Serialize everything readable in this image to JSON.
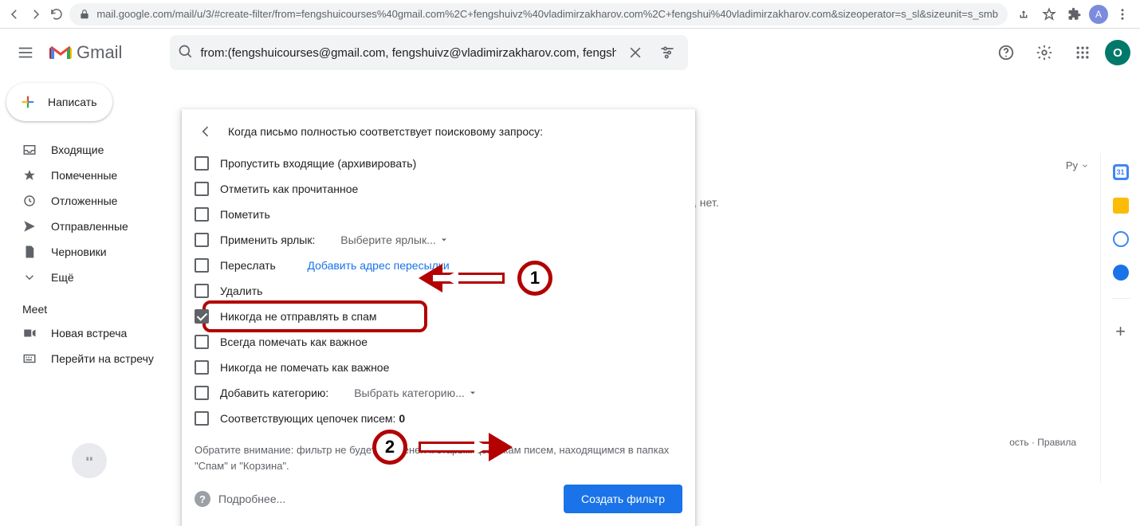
{
  "chrome": {
    "url": "mail.google.com/mail/u/3/#create-filter/from=fengshuicourses%40gmail.com%2C+fengshuivz%40vladimirzakharov.com%2C+fengshui%40vladimirzakharov.com&sizeoperator=s_sl&sizeunit=s_smb",
    "avatar_initial": "A"
  },
  "header": {
    "logo_text": "Gmail",
    "search_value": "from:(fengshuicourses@gmail.com, fengshuivz@vladimirzakharov.com, fengshu",
    "avatar_initial": "O"
  },
  "sidebar": {
    "compose_label": "Написать",
    "items": [
      {
        "label": "Входящие"
      },
      {
        "label": "Помеченные"
      },
      {
        "label": "Отложенные"
      },
      {
        "label": "Отправленные"
      },
      {
        "label": "Черновики"
      },
      {
        "label": "Ещё"
      }
    ],
    "meet_title": "Meet",
    "meet_items": [
      {
        "label": "Новая встреча"
      },
      {
        "label": "Перейти на встречу"
      }
    ]
  },
  "dialog": {
    "head": "Когда письмо полностью соответствует поисковому запросу:",
    "options": {
      "archive": "Пропустить входящие (архивировать)",
      "mark_read": "Отметить как прочитанное",
      "star": "Пометить",
      "apply_label": "Применить ярлык:",
      "apply_label_drop": "Выберите ярлык...",
      "forward": "Переслать",
      "forward_link": "Добавить адрес пересылки",
      "delete": "Удалить",
      "never_spam": "Никогда не отправлять в спам",
      "always_important": "Всегда помечать как важное",
      "never_important": "Никогда не помечать как важное",
      "add_category": "Добавить категорию:",
      "add_category_drop": "Выбрать категорию...",
      "matching_prefix": "Соответствующих цепочек писем: ",
      "matching_count": "0"
    },
    "note": "Обратите внимание: фильтр не будет применен к старым цепочкам писем, находящимся в папках \"Спам\" и \"Корзина\".",
    "more": "Подробнее...",
    "create_label": "Создать фильтр"
  },
  "annotations": {
    "n1": "1",
    "n2": "2"
  },
  "behind": {
    "text": ", нет.",
    "footer": "ость · Правила"
  },
  "lang": "Ру"
}
